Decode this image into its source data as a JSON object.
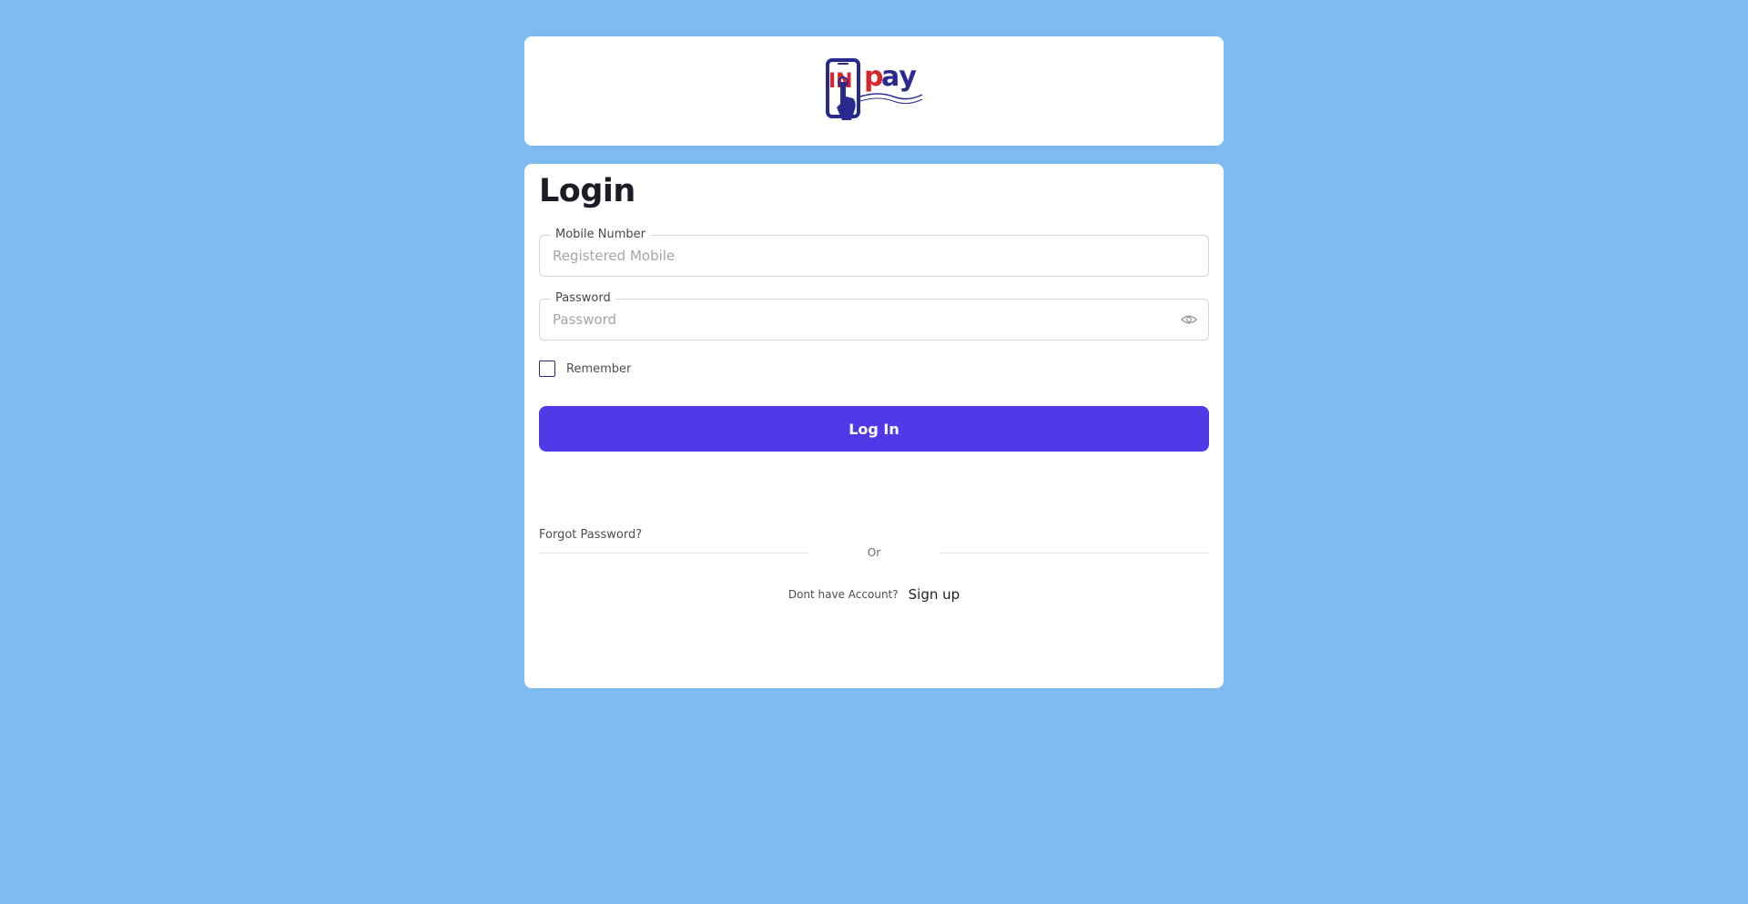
{
  "logo": {
    "text": "INpay",
    "brand_blue": "#2a2a8e",
    "brand_red": "#d7262b"
  },
  "login": {
    "title": "Login",
    "mobile": {
      "label": "Mobile Number",
      "placeholder": "Registered Mobile",
      "value": ""
    },
    "password": {
      "label": "Password",
      "placeholder": "Password",
      "value": "",
      "toggle_icon": "eye-icon"
    },
    "remember": {
      "label": "Remember",
      "checked": false
    },
    "submit_label": "Log In",
    "forgot_label": "Forgot Password?",
    "or_label": "Or",
    "no_account_label": "Dont have Account?",
    "signup_label": "Sign up"
  },
  "colors": {
    "background": "#7fbbf3",
    "primary_button": "#5139e8",
    "card": "#ffffff"
  }
}
